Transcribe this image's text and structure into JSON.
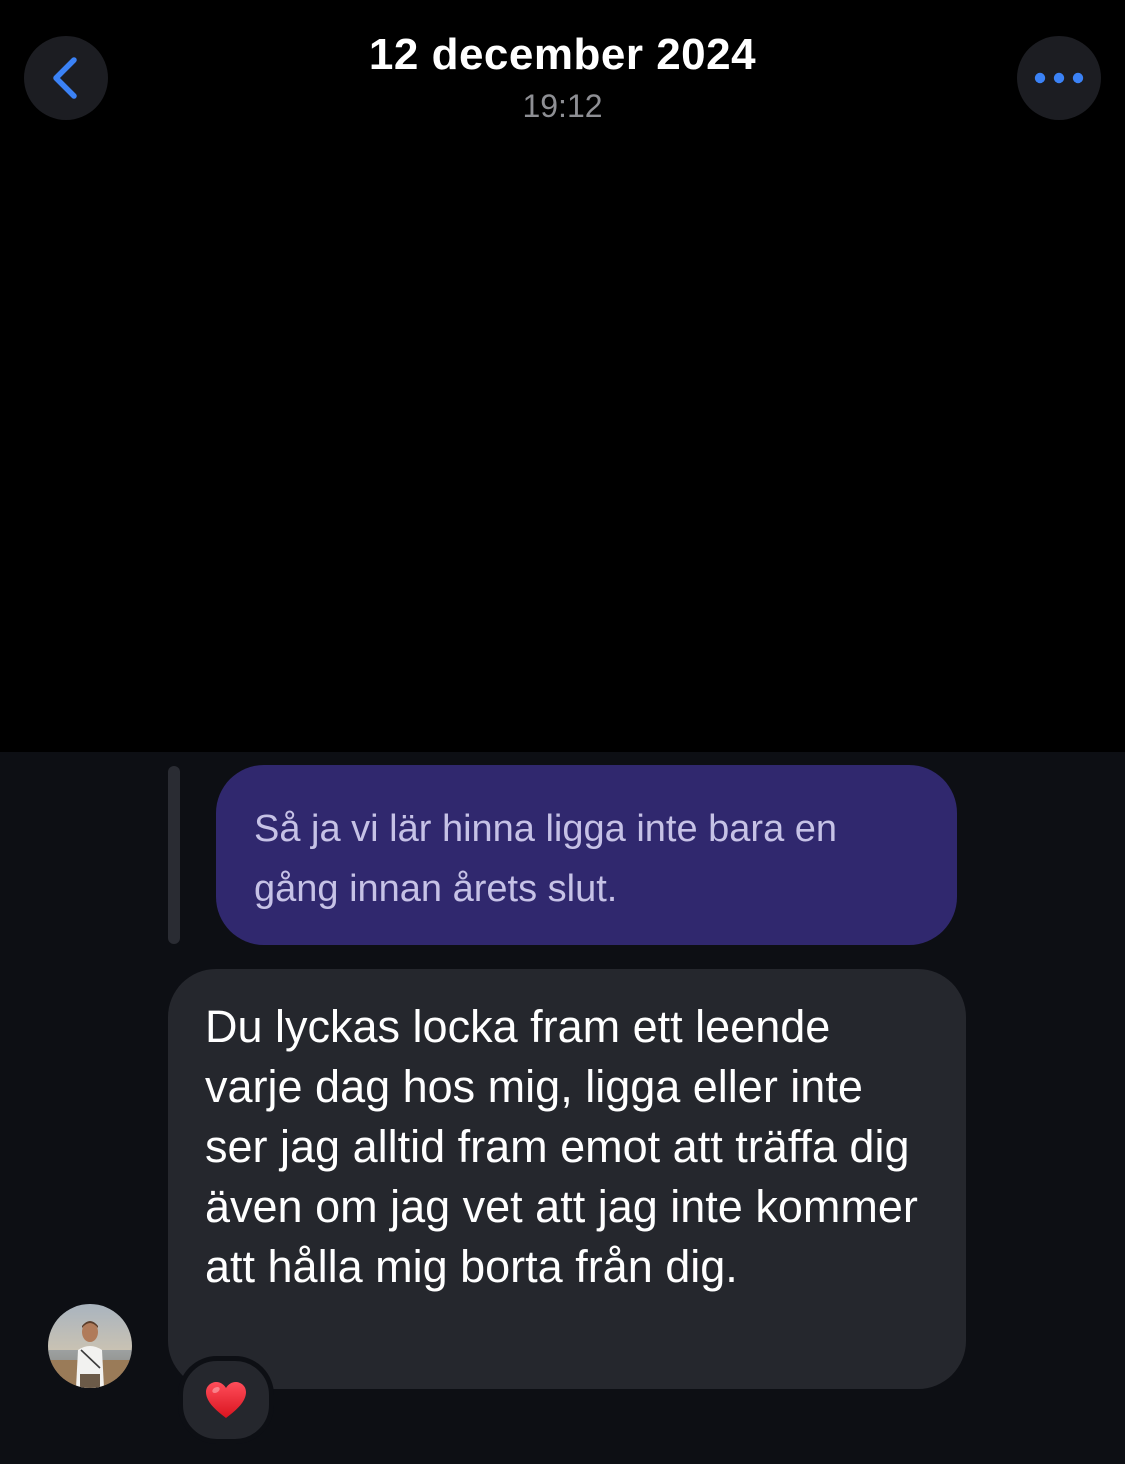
{
  "header": {
    "title": "12 december 2024",
    "subtitle": "19:12",
    "back_icon": "chevron-left-icon",
    "more_icon": "ellipsis-icon",
    "accent_color": "#3b82f6"
  },
  "thread": {
    "quoted_message": {
      "text": "Så ja vi lär hinna ligga inte bara en gång innan årets slut."
    },
    "incoming_message": {
      "text": "Du lyckas locka fram ett leende varje dag hos mig, ligga eller inte ser jag alltid fram emot att träffa dig även om jag vet att jag inte kommer att hålla mig borta från dig.",
      "reaction": "heart-reaction-icon"
    },
    "avatar": "profile-avatar"
  },
  "colors": {
    "background": "#000000",
    "thread_background": "#0d0f14",
    "quoted_bubble": "#30286e",
    "incoming_bubble": "#25272d",
    "heart": "#e0202e"
  }
}
